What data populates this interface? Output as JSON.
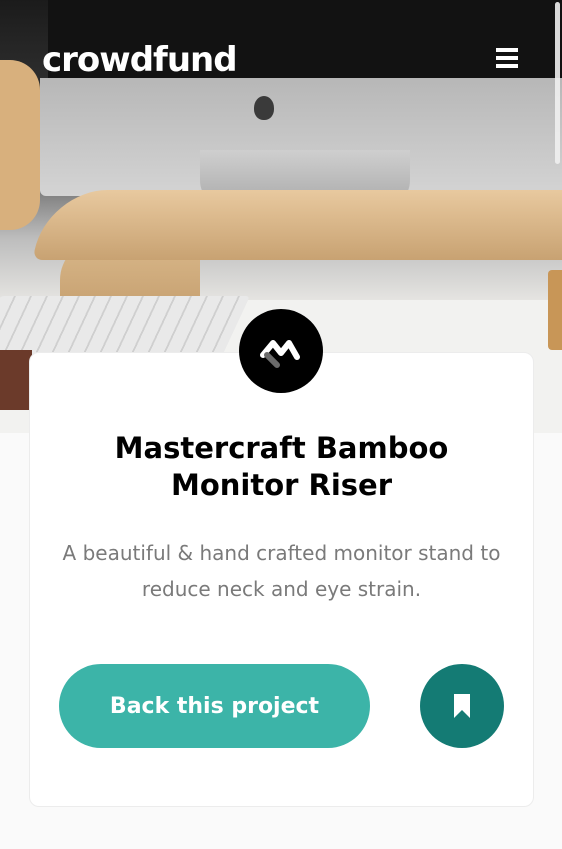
{
  "header": {
    "logo_text": "crowdfund",
    "menu_icon": "hamburger-menu-icon"
  },
  "hero": {
    "image_description": "photo-of-monitor-on-bamboo-riser"
  },
  "project": {
    "logo_icon": "mastercraft-logo-icon",
    "title": "Mastercraft Bamboo Monitor Riser",
    "description": "A beautiful & hand crafted monitor stand to reduce neck and eye strain.",
    "back_button_label": "Back this project",
    "bookmark_icon": "bookmark-icon"
  },
  "colors": {
    "primary": "#3cb4a8",
    "primary_dark": "#147b74",
    "text_dark": "#000000",
    "text_muted": "#7a7a7a"
  }
}
